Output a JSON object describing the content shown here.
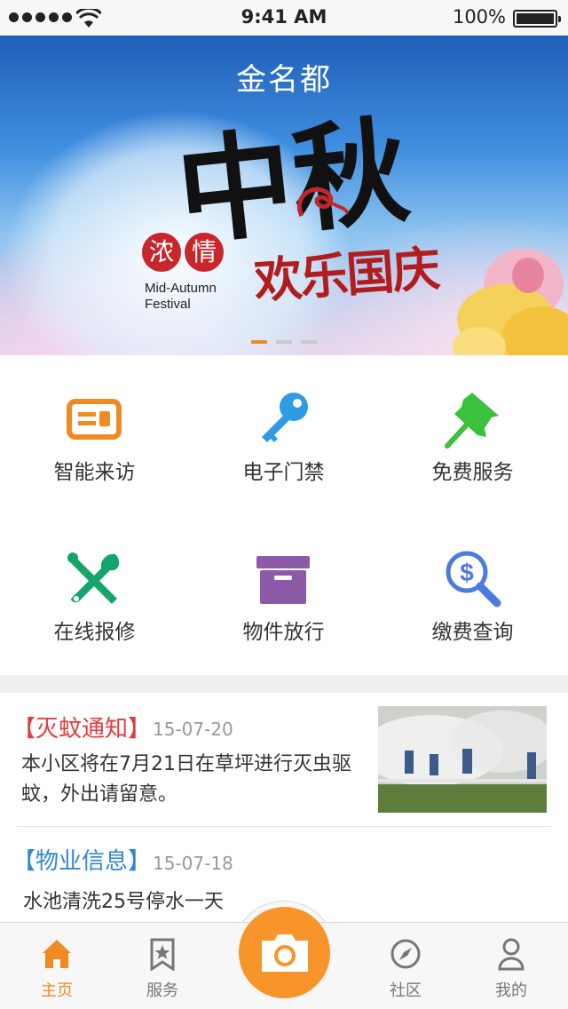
{
  "status_bar": {
    "time": "9:41 AM",
    "battery": "100%"
  },
  "banner": {
    "title": "金名都",
    "calligraphy_main": "中秋",
    "calligraphy_sub": "欢乐国庆",
    "badge_chars": [
      "浓",
      "情"
    ],
    "english_line1": "Mid-Autumn",
    "english_line2": "Festival",
    "active_page": 1,
    "page_count": 3
  },
  "features": [
    {
      "label": "智能来访",
      "icon": "visitor-card-icon",
      "color": "#f08a24"
    },
    {
      "label": "电子门禁",
      "icon": "key-icon",
      "color": "#2f9be3"
    },
    {
      "label": "免费服务",
      "icon": "pushpin-icon",
      "color": "#3cc13c"
    },
    {
      "label": "在线报修",
      "icon": "wrench-screwdriver-icon",
      "color": "#15a56b"
    },
    {
      "label": "物件放行",
      "icon": "box-icon",
      "color": "#8c5aa6"
    },
    {
      "label": "缴费查询",
      "icon": "dollar-search-icon",
      "color": "#4c7be0"
    }
  ],
  "news": [
    {
      "tag": "【灭蚊通知】",
      "date": "15-07-20",
      "body": "本小区将在7月21日在草坪进行灭虫驱蚊，外出请留意。",
      "tag_color": "#e53a3a"
    },
    {
      "tag": "【物业信息】",
      "date": "15-07-18",
      "body": "水池清洗25号停水一天",
      "tag_color": "#2f86d6"
    }
  ],
  "tabbar": {
    "items": [
      {
        "label": "主页",
        "icon": "home-icon",
        "active": true
      },
      {
        "label": "服务",
        "icon": "bookmark-star-icon",
        "active": false
      },
      {
        "label": "",
        "icon": "camera-icon",
        "active": false
      },
      {
        "label": "社区",
        "icon": "compass-icon",
        "active": false
      },
      {
        "label": "我的",
        "icon": "person-icon",
        "active": false
      }
    ],
    "accent": "#f28a22"
  }
}
